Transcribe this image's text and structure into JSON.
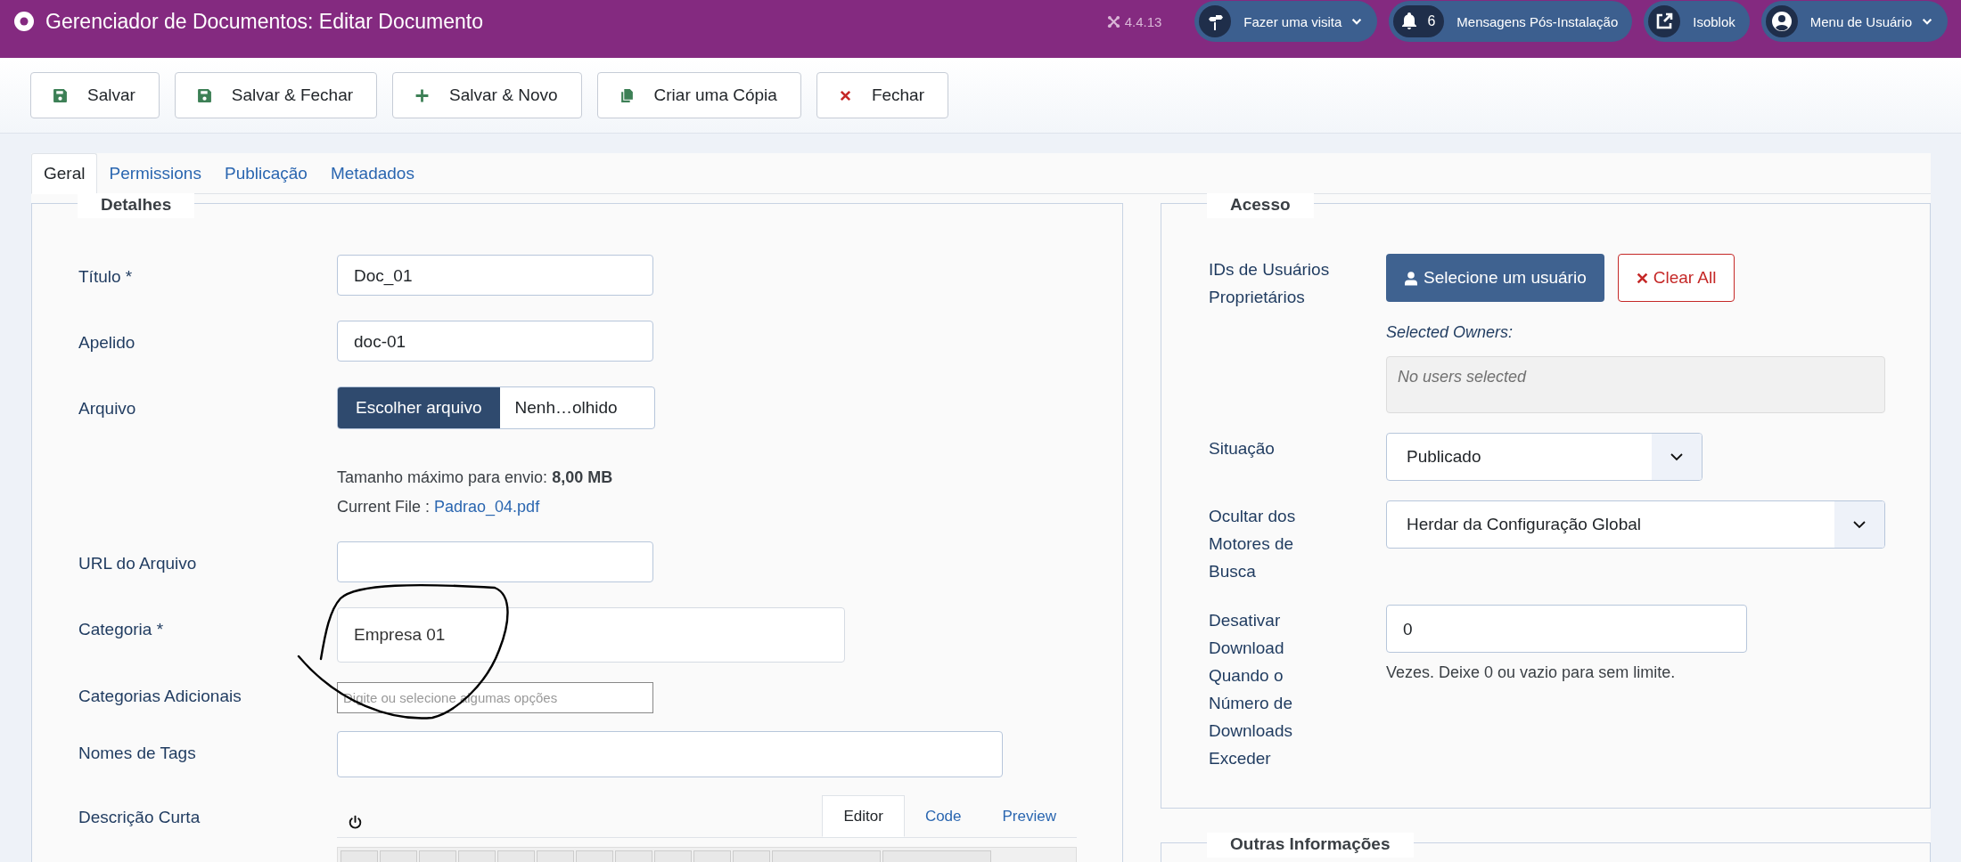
{
  "header": {
    "title": "Gerenciador de Documentos: Editar Documento",
    "version": "4.4.13",
    "actions": [
      {
        "label": "Fazer uma visita",
        "kind": "tour",
        "dropdown": true
      },
      {
        "label": "Mensagens Pós-Instalação",
        "kind": "bell",
        "count": "6",
        "dropdown": false
      },
      {
        "label": "Isoblok",
        "kind": "external",
        "dropdown": false
      },
      {
        "label": "Menu de Usuário",
        "kind": "user",
        "dropdown": true
      }
    ]
  },
  "toolbar": [
    {
      "label": "Salvar",
      "kind": "save"
    },
    {
      "label": "Salvar & Fechar",
      "kind": "save"
    },
    {
      "label": "Salvar & Novo",
      "kind": "new"
    },
    {
      "label": "Criar uma Cópia",
      "kind": "copy"
    },
    {
      "label": "Fechar",
      "kind": "close"
    }
  ],
  "tabs": [
    {
      "label": "Geral",
      "selected": true
    },
    {
      "label": "Permissions",
      "selected": false
    },
    {
      "label": "Publicação",
      "selected": false
    },
    {
      "label": "Metadados",
      "selected": false
    }
  ],
  "details": {
    "legend": "Detalhes",
    "fields": [
      {
        "kind": "text",
        "label": "Título *",
        "value": "Doc_01"
      },
      {
        "kind": "text",
        "label": "Apelido",
        "value": "doc-01"
      },
      {
        "kind": "file",
        "label": "Arquivo",
        "button": "Escolher arquivo",
        "filename": "Nenh…olhido",
        "max_size": "Tamanho máximo para envio: **8,00 MB**",
        "current_file_label": "Current File :",
        "current_file": "Padrao_04.pdf"
      },
      {
        "kind": "text",
        "label": "URL do Arquivo"
      },
      {
        "kind": "choice",
        "label": "Categoria *",
        "value": "Empresa 01"
      },
      {
        "kind": "multi",
        "label": "Categorias Adicionais",
        "placeholder": "Digite ou selecione algumas opções"
      },
      {
        "kind": "tags",
        "label": "Nomes de Tags"
      },
      {
        "kind": "editor",
        "label": "Descrição Curta",
        "tabs": [
          {
            "label": "Editor",
            "selected": true
          },
          {
            "label": "Code",
            "selected": false
          },
          {
            "label": "Preview",
            "selected": false
          }
        ]
      }
    ]
  },
  "access": {
    "legend": "Acesso",
    "owners": {
      "label": "IDs de Usuários Proprietários",
      "select_button": "Selecione um usuário",
      "clear_button": "Clear All",
      "selected_label": "Selected Owners:",
      "empty": "No users selected"
    },
    "status": {
      "label": "Situação",
      "value": "Publicado"
    },
    "robots": {
      "label": "Ocultar dos Motores de Busca",
      "value": "Herdar da Configuração Global"
    },
    "download_limit": {
      "label": "Desativar Download Quando o Número de Downloads Exceder",
      "value": "0",
      "help": "Vezes. Deixe 0 ou vazio para sem limite."
    }
  },
  "other": {
    "legend": "Outras Informações"
  }
}
